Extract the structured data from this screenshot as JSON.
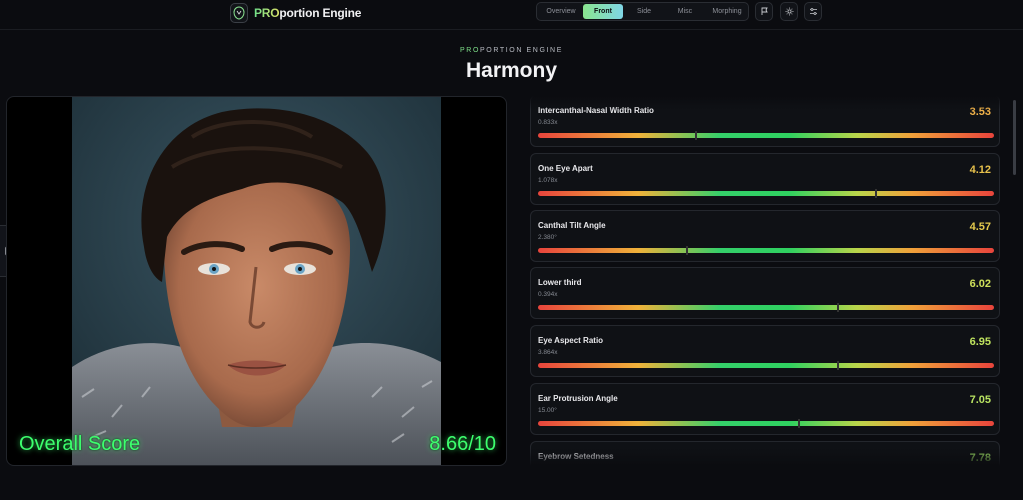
{
  "header": {
    "brand_pro": "PRO",
    "brand_rest": "portion Engine",
    "tabs": [
      {
        "label": "Overview",
        "active": false
      },
      {
        "label": "Front",
        "active": true
      },
      {
        "label": "Side",
        "active": false
      },
      {
        "label": "Misc",
        "active": false
      },
      {
        "label": "Morphing",
        "active": false
      }
    ],
    "icons": [
      "flag-icon",
      "sun-icon",
      "sliders-icon"
    ]
  },
  "heading": {
    "kicker_pro": "PRO",
    "kicker_rest": "PORTION ENGINE",
    "title": "Harmony"
  },
  "photo": {
    "overall_label": "Overall Score",
    "overall_value": "8.66/10"
  },
  "metrics": [
    {
      "name": "Intercanthal-Nasal Width Ratio",
      "value": "0.833x",
      "score": "3.53",
      "score_color": "#f0b24a",
      "marker": 0.345
    },
    {
      "name": "One Eye Apart",
      "value": "1.078x",
      "score": "4.12",
      "score_color": "#e7c14c",
      "marker": 0.74
    },
    {
      "name": "Canthal Tilt Angle",
      "value": "2.380°",
      "score": "4.57",
      "score_color": "#e5cb4d",
      "marker": 0.325
    },
    {
      "name": "Lower third",
      "value": "0.394x",
      "score": "6.02",
      "score_color": "#cfe05a",
      "marker": 0.655
    },
    {
      "name": "Eye Aspect Ratio",
      "value": "3.864x",
      "score": "6.95",
      "score_color": "#bfe35e",
      "marker": 0.655
    },
    {
      "name": "Ear Protrusion Angle",
      "value": "15.00°",
      "score": "7.05",
      "score_color": "#b9e462",
      "marker": 0.57
    },
    {
      "name": "Eyebrow Setedness",
      "value": "",
      "score": "7.78",
      "score_color": "#9fe266",
      "marker": 0.6
    }
  ]
}
